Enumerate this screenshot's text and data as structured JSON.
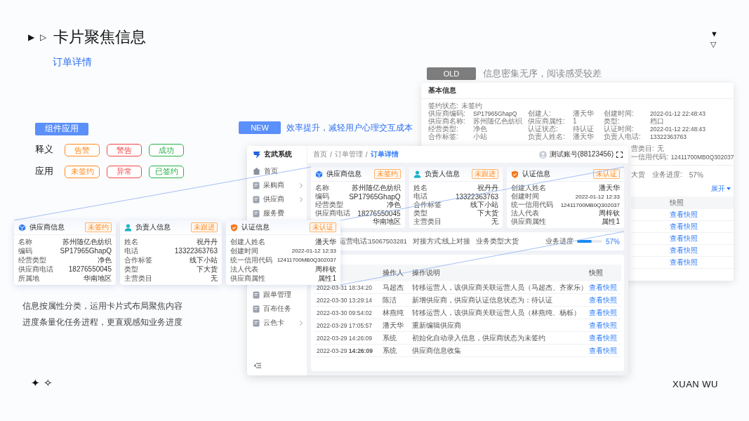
{
  "title": {
    "markers": [
      "▶",
      "▷"
    ],
    "text": "卡片聚焦信息",
    "subtitle": "订单详情"
  },
  "corner_marks": [
    "▼",
    "▽"
  ],
  "legend": {
    "heading": "组件应用",
    "rows": [
      {
        "label": "释义",
        "tags": [
          {
            "text": "告警",
            "color": "#ff8a1f"
          },
          {
            "text": "警告",
            "color": "#f04848"
          },
          {
            "text": "成功",
            "color": "#27b148"
          }
        ]
      },
      {
        "label": "应用",
        "tags": [
          {
            "text": "未签约",
            "color": "#ff8a1f"
          },
          {
            "text": "异常",
            "color": "#f04848"
          },
          {
            "text": "已签约",
            "color": "#27b148"
          }
        ]
      }
    ]
  },
  "old": {
    "label": "OLD",
    "caption": "信息密集无序，阅读感受较差",
    "window": {
      "section_title": "基本信息",
      "status": {
        "label": "签约状态:",
        "value": "未签约"
      },
      "field_rows": [
        [
          {
            "label": "供应商编码:",
            "value": "SP17965GhapQ"
          },
          {
            "label": "创建人:",
            "value": "潘天华"
          },
          {
            "label": "创建时间:",
            "value": "2022-01-12  22:48:43"
          }
        ],
        [
          {
            "label": "供应商名称:",
            "value": "苏州随亿色纺织"
          },
          {
            "label": "供应商属性:",
            "value": "1"
          },
          {
            "label": "类型:",
            "value": "档口"
          }
        ],
        [
          {
            "label": "经营类型:",
            "value": "净色"
          },
          {
            "label": "认证状态:",
            "value": "待认证"
          },
          {
            "label": "认证时间:",
            "value": "2022-01-12  22:48:43"
          }
        ],
        [
          {
            "label": "合作标签:",
            "value": "小站"
          },
          {
            "label": "负责人姓名:",
            "value": "潘天华"
          },
          {
            "label": "负责人电话:",
            "value": "13322363763"
          }
        ]
      ],
      "side_fields": [
        {
          "label": "营类目:",
          "value": "无"
        },
        {
          "label": "一信用代码:",
          "value": "12411700MB0Q302037"
        }
      ],
      "business_type": "大货",
      "progress_label": "业务进度:",
      "progress_value": "57%",
      "expand": "展开",
      "table": {
        "header": "快照",
        "rows": [
          "查看快照",
          "查看快照",
          "查看快照",
          "查看快照",
          "查看快照"
        ]
      }
    }
  },
  "new": {
    "label": "NEW",
    "caption": "效率提升，减轻用户心理交互成本",
    "window": {
      "logo": "玄武系统",
      "breadcrumb": {
        "separator": "/",
        "items": [
          {
            "text": "首页",
            "current": false
          },
          {
            "text": "订单管理",
            "current": false
          },
          {
            "text": "订单详情",
            "current": true
          }
        ]
      },
      "user": "测试账号(88123456)",
      "sidebar": {
        "items": [
          {
            "label": "首页",
            "expandable": false
          },
          {
            "label": "采购商",
            "expandable": true
          },
          {
            "label": "供应商",
            "expandable": true
          },
          {
            "label": "服务费",
            "expandable": false
          }
        ],
        "more_items": [
          {
            "label": "跟单管理",
            "expandable": false
          },
          {
            "label": "百布任务",
            "expandable": false
          },
          {
            "label": "云色卡",
            "expandable": true
          }
        ]
      },
      "cards": [
        {
          "kind": "supplier",
          "title": "供应商信息",
          "badge": "未签约",
          "rows": [
            {
              "label": "名称",
              "value": "苏州随亿色纺织"
            },
            {
              "label": "编码",
              "value": "SP17965GhapQ"
            },
            {
              "label": "经营类型",
              "value": "净色"
            },
            {
              "label": "供应商电话",
              "value": "18276550045"
            },
            {
              "value": "华南地区"
            }
          ]
        },
        {
          "kind": "contact",
          "title": "负责人信息",
          "badge": "未跟进",
          "rows": [
            {
              "label": "姓名",
              "value": "祝丹丹"
            },
            {
              "label": "电话",
              "value": "13322363763"
            },
            {
              "label": "合作标签",
              "value": "线下小站"
            },
            {
              "label": "类型",
              "value": "下大货"
            },
            {
              "label": "主营类目",
              "value": "无"
            }
          ]
        },
        {
          "kind": "certification",
          "title": "认证信息",
          "badge": "未认证",
          "rows": [
            {
              "label": "创建人姓名",
              "value": "潘天华"
            },
            {
              "label": "创建时间",
              "value": "2022-01-12 12:33"
            },
            {
              "label": "统一信用代码",
              "value": "12411700MB0Q302037"
            },
            {
              "label": "法人代表",
              "value": "周梓钦"
            },
            {
              "label": "供应商属性",
              "value": "属性1"
            }
          ]
        }
      ],
      "info_bar": {
        "fields": [
          {
            "label": "运营电话:",
            "value": "15067503281"
          },
          {
            "label": "对接方式:",
            "value": "线上对接"
          },
          {
            "label": "业务类型:",
            "value": "大货"
          }
        ],
        "progress": {
          "label": "业务进度",
          "level": 0.57,
          "reading": "57%"
        }
      },
      "table": {
        "columns": [
          "操作人",
          "操作说明",
          "快照"
        ],
        "rows": [
          {
            "time": "2022-03-31 18:34:20",
            "operator": "马超杰",
            "description": "转移运营人，该供应商关联运营人员（马超杰、齐家乐）",
            "action": "查看快照"
          },
          {
            "time": "2022-03-30 13:29:14",
            "operator": "陈洁",
            "description": "新增供应商，供应商认证信息状态为：待认证",
            "action": "查看快照"
          },
          {
            "time": "2022-03-30 09:54:02",
            "operator": "林燕纯",
            "description": "转移运营人，该供应商关联运营人员（林燕纯、杨栎）",
            "action": "查看快照"
          },
          {
            "time": "2022-03-29 17:05:57",
            "operator": "潘天华",
            "description": "重新编辑供应商",
            "action": "查看快照"
          },
          {
            "time": "2022-03-29 14:26:09",
            "operator": "系统",
            "description": "初始化自动录入信息，供应商状态为未签约",
            "action": "查看快照"
          },
          {
            "time": "2022-03-29 **14:26:09**",
            "operator": "系统",
            "description": "供应商信息收集",
            "action": "查看快照"
          }
        ]
      }
    }
  },
  "callout_cards": [
    {
      "kind": "supplier",
      "title": "供应商信息",
      "badge": "未签约",
      "rows": [
        {
          "label": "名称",
          "value": "苏州随亿色纺织"
        },
        {
          "label": "编码",
          "value": "SP17965GhapQ"
        },
        {
          "label": "经营类型",
          "value": "净色"
        },
        {
          "label": "供应商电话",
          "value": "18276550045"
        },
        {
          "label": "所属地",
          "value": "华南地区"
        }
      ]
    },
    {
      "kind": "contact",
      "title": "负责人信息",
      "badge": "未跟进",
      "rows": [
        {
          "label": "姓名",
          "value": "祝丹丹"
        },
        {
          "label": "电话",
          "value": "13322363763"
        },
        {
          "label": "合作标签",
          "value": "线下小站"
        },
        {
          "label": "类型",
          "value": "下大货"
        },
        {
          "label": "主营类目",
          "value": "无"
        }
      ]
    },
    {
      "kind": "certification",
      "title": "认证信息",
      "badge": "未认证",
      "rows": [
        {
          "label": "创建人姓名",
          "value": "潘天华"
        },
        {
          "label": "创建时间",
          "value": "2022-01-12 12:33"
        },
        {
          "label": "统一信用代码",
          "value": "12411700MB0Q302037"
        },
        {
          "label": "法人代表",
          "value": "周梓钦"
        },
        {
          "label": "供应商属性",
          "value": "属性1"
        }
      ]
    }
  ],
  "description": [
    "信息按属性分类，运用卡片式布局聚焦内容",
    "进度条量化任务进程，更直观感知业务进度"
  ],
  "footer": {
    "marks": [
      "✦",
      "✧"
    ],
    "brand": "XUAN WU"
  }
}
